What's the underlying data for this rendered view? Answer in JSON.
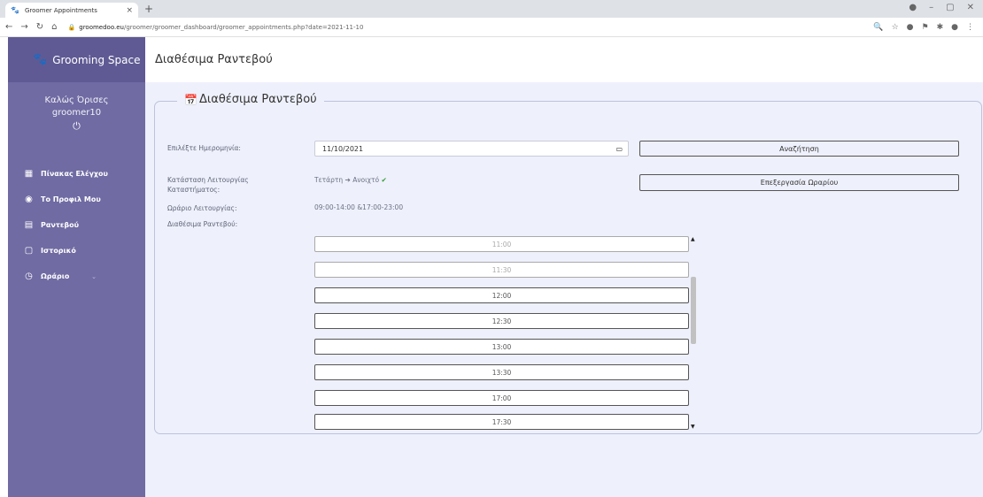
{
  "browser": {
    "tab_title": "Groomer Appointments",
    "tab_close": "×",
    "new_tab": "+",
    "url_domain": "groomedoo.eu",
    "url_path": "/groomer/groomer_dashboard/groomer_appointments.php?date=2021-11-10"
  },
  "sidebar": {
    "brand": "Grooming Space",
    "welcome": "Καλώς Όρισες",
    "username": "groomer10",
    "items": [
      {
        "label": "Πίνακας Ελέγχου",
        "icon": "dashboard-icon"
      },
      {
        "label": "Το Προφιλ Μου",
        "icon": "user-icon"
      },
      {
        "label": "Ραντεβού",
        "icon": "calendar-icon"
      },
      {
        "label": "Ιστορικό",
        "icon": "history-icon"
      },
      {
        "label": "Ωράριο",
        "icon": "clock-icon"
      }
    ]
  },
  "header": {
    "title": "Διαθέσιμα Ραντεβού"
  },
  "form": {
    "legend": "Διαθέσιμα Ραντεβού",
    "date_label": "Επιλέξτε Ημερομηνία:",
    "date_value": "11/10/2021",
    "search_button": "Αναζήτηση",
    "status_label_line1": "Κατάσταση Λειτουργίας",
    "status_label_line2": "Καταστήματος:",
    "status_day": "Τετάρτη",
    "status_arrow": "➔",
    "status_value": "Ανοιχτό",
    "edit_hours_button": "Επεξεργασία Ωραρίου",
    "hours_label": "Ωράριο Λειτουργίας:",
    "hours_value": "09:00-14:00 &17:00-23:00",
    "slots_label": "Διαθέσιμα Ραντεβού:"
  },
  "slots": [
    {
      "time": "11:00",
      "past": true
    },
    {
      "time": "11:30",
      "past": true
    },
    {
      "time": "12:00",
      "past": false
    },
    {
      "time": "12:30",
      "past": false
    },
    {
      "time": "13:00",
      "past": false
    },
    {
      "time": "13:30",
      "past": false
    },
    {
      "time": "17:00",
      "past": false
    },
    {
      "time": "17:30",
      "past": false
    }
  ],
  "colors": {
    "sidebar": "#706ba3",
    "sidebar_brand": "#5f5a94",
    "main_bg": "#eef0fb",
    "status_check": "#2e9a35"
  }
}
